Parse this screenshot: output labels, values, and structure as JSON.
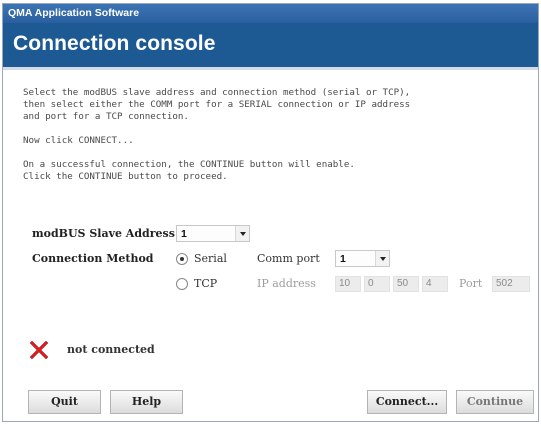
{
  "window": {
    "title": "QMA Application Software"
  },
  "header": {
    "title": "Connection console"
  },
  "instructions": [
    "Select the modBUS slave address and connection method (serial or TCP),\nthen select either the COMM port for a SERIAL connection or IP address\nand port for a TCP connection.",
    "Now click CONNECT...",
    "On a successful connection, the CONTINUE button will enable.\nClick the CONTINUE button to proceed."
  ],
  "form": {
    "slave_address_label": "modBUS Slave Address",
    "slave_address_value": "1",
    "connection_method_label": "Connection Method",
    "serial_label": "Serial",
    "serial_selected": true,
    "tcp_label": "TCP",
    "comm_port_label": "Comm port",
    "comm_port_value": "1",
    "ip_address_label": "IP address",
    "ip_octets": [
      "10",
      "0",
      "50",
      "4"
    ],
    "port_label": "Port",
    "port_value": "502"
  },
  "status": {
    "icon": "red-x-icon",
    "text": "not connected",
    "color": "#d81e1e"
  },
  "buttons": {
    "quit": "Quit",
    "help": "Help",
    "connect": "Connect...",
    "continue": "Continue"
  },
  "colors": {
    "titlebar": "#2f66a8",
    "header": "#1d5a93"
  }
}
